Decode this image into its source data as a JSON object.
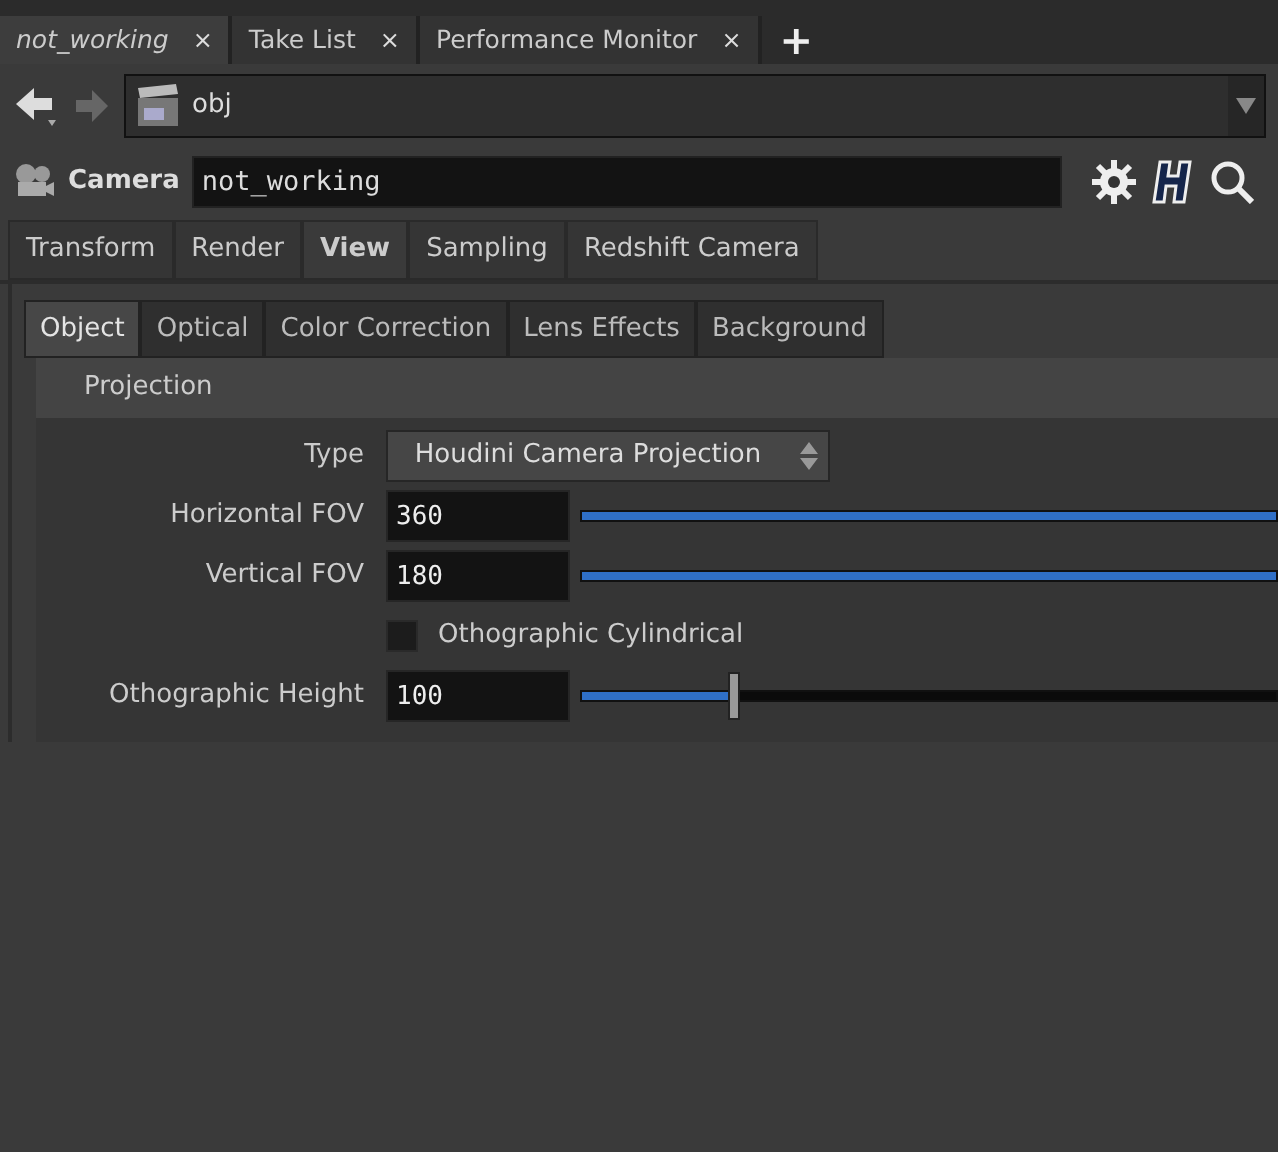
{
  "pane_tabs": [
    {
      "label": "not_working",
      "selected": true
    },
    {
      "label": "Take List",
      "selected": false
    },
    {
      "label": "Performance Monitor",
      "selected": false
    }
  ],
  "new_tab": "+",
  "close_glyph": "×",
  "path": {
    "value": "obj"
  },
  "node": {
    "type": "Camera",
    "name": "not_working"
  },
  "main_tabs": [
    {
      "label": "Transform",
      "selected": false
    },
    {
      "label": "Render",
      "selected": false
    },
    {
      "label": "View",
      "selected": true
    },
    {
      "label": "Sampling",
      "selected": false
    },
    {
      "label": "Redshift Camera",
      "selected": false
    }
  ],
  "sub_tabs": [
    {
      "label": "Object",
      "selected": true
    },
    {
      "label": "Optical",
      "selected": false
    },
    {
      "label": "Color Correction",
      "selected": false
    },
    {
      "label": "Lens Effects",
      "selected": false
    },
    {
      "label": "Background",
      "selected": false
    }
  ],
  "section": "Projection",
  "params": [
    {
      "kind": "menu",
      "label": "Type",
      "value": "Houdini Camera Projection"
    },
    {
      "kind": "slider",
      "label": "Horizontal FOV",
      "value": "360",
      "level": 1
    },
    {
      "kind": "slider",
      "label": "Vertical FOV",
      "value": "180",
      "level": 1
    },
    {
      "kind": "checkbox",
      "label": "Othographic Cylindrical",
      "checked": false
    },
    {
      "kind": "slider",
      "label": "Othographic Height",
      "value": "100",
      "level": 0.22
    }
  ]
}
